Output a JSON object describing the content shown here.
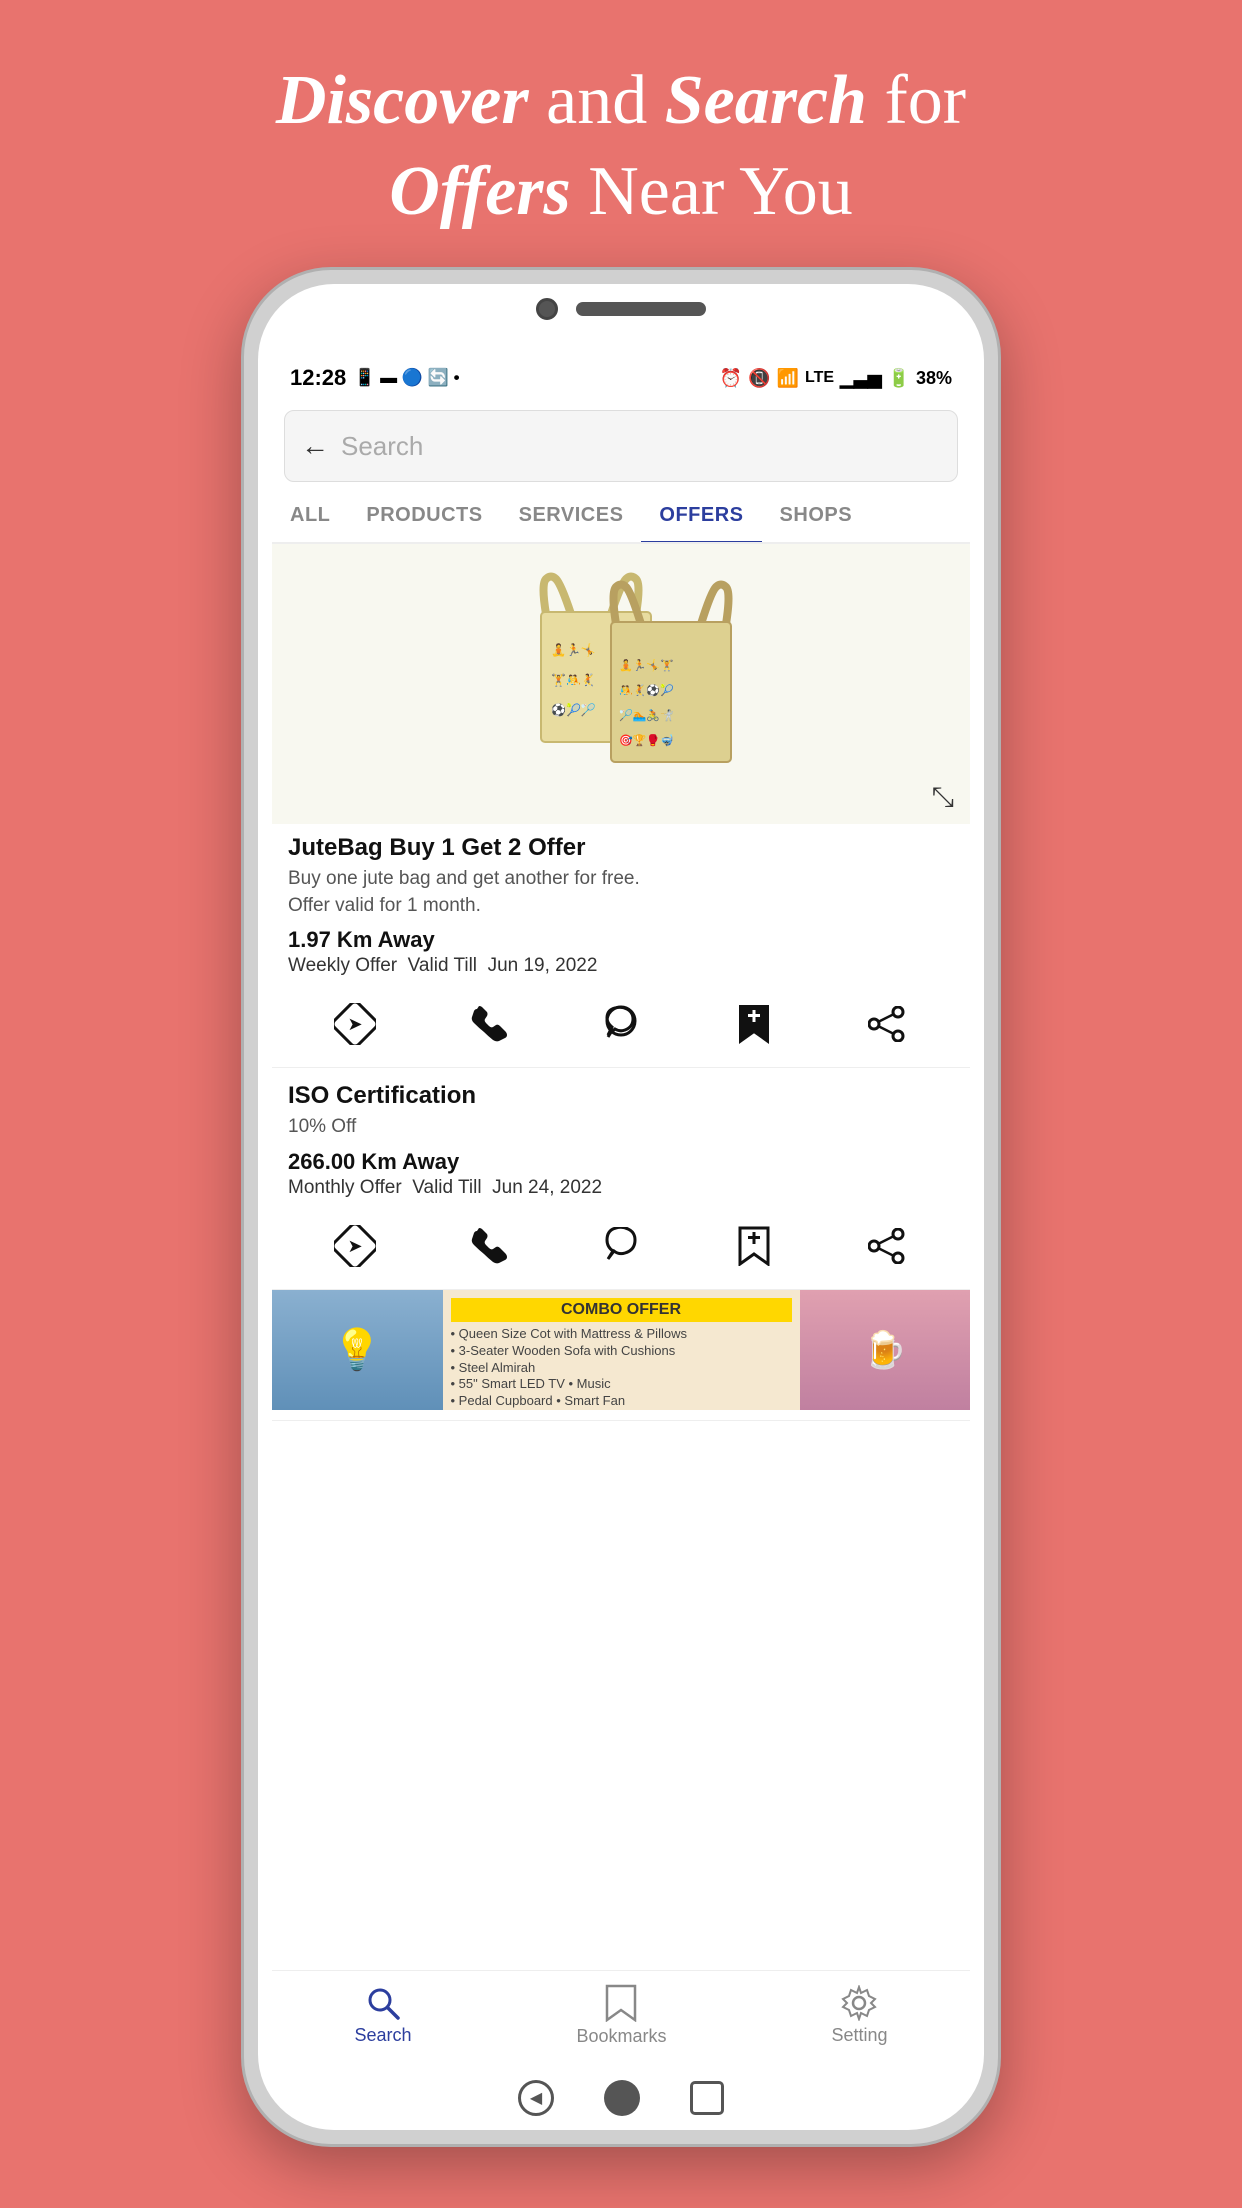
{
  "header": {
    "line1_plain": "and ",
    "line1_bold1": "Discover",
    "line1_bold2": "Search",
    "line1_suffix": " for",
    "line2_bold": "Offers",
    "line2_plain": " Near You"
  },
  "status_bar": {
    "time": "12:28",
    "battery": "38%",
    "signal": "LTE"
  },
  "search": {
    "placeholder": "Search",
    "back_label": "←"
  },
  "tabs": [
    {
      "label": "ALL",
      "active": false
    },
    {
      "label": "PRODUCTS",
      "active": false
    },
    {
      "label": "SERVICES",
      "active": false
    },
    {
      "label": "OFFERS",
      "active": true
    },
    {
      "label": "SHOPS",
      "active": false
    }
  ],
  "offers": [
    {
      "id": 1,
      "title": "JuteBag Buy 1 Get 2 Offer",
      "description": "Buy one jute bag and get another for free.\nOffer valid for 1 month.",
      "distance": "1.97 Km Away",
      "offer_type": "Weekly Offer",
      "valid_till_label": "Valid Till",
      "valid_date": "Jun 19, 2022",
      "has_image": true,
      "bookmark_filled": true
    },
    {
      "id": 2,
      "title": "ISO Certification",
      "description": "10% Off",
      "distance": "266.00 Km Away",
      "offer_type": "Monthly Offer",
      "valid_till_label": "Valid Till",
      "valid_date": "Jun 24, 2022",
      "has_image": false,
      "bookmark_filled": false
    },
    {
      "id": 3,
      "title": "COMBO OFFER",
      "has_image": true
    }
  ],
  "bottom_nav": [
    {
      "label": "Search",
      "active": true,
      "icon": "search"
    },
    {
      "label": "Bookmarks",
      "active": false,
      "icon": "bookmark"
    },
    {
      "label": "Setting",
      "active": false,
      "icon": "gear"
    }
  ]
}
